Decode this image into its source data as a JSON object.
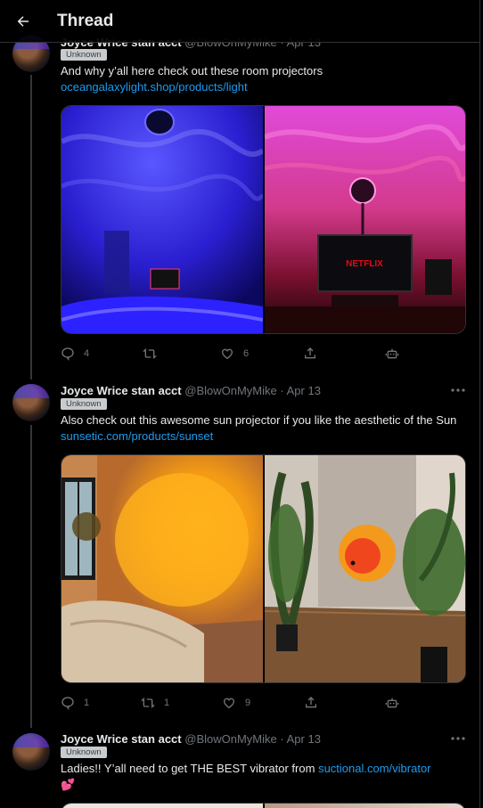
{
  "header": {
    "title": "Thread"
  },
  "tweets": [
    {
      "name": "Joyce Wrice stan acct",
      "handle": "@BlowOnMyMike",
      "date": "Apr 13",
      "badge": "Unknown",
      "text_before": "And why y’all here check out these room projectors",
      "link": "oceangalaxylight.shop/products/light",
      "reply_count": "4",
      "retweet_count": "",
      "like_count": "6"
    },
    {
      "name": "Joyce Wrice stan acct",
      "handle": "@BlowOnMyMike",
      "date": "Apr 13",
      "badge": "Unknown",
      "text_before": "Also check out this awesome sun projector if you like the aesthetic of the Sun",
      "link": "sunsetic.com/products/sunset",
      "reply_count": "1",
      "retweet_count": "1",
      "like_count": "9"
    },
    {
      "name": "Joyce Wrice stan acct",
      "handle": "@BlowOnMyMike",
      "date": "Apr 13",
      "badge": "Unknown",
      "text_before": "Ladies!! Y’all need to get THE BEST vibrator from",
      "link": "suctional.com/vibrator",
      "emoji": "💕"
    }
  ],
  "media_text": {
    "tv_label": "NETFLIX"
  },
  "icons": {
    "back": "arrow-left-icon",
    "reply": "reply-icon",
    "retweet": "retweet-icon",
    "like": "heart-icon",
    "share": "share-icon",
    "bot": "robot-icon",
    "more": "more-icon"
  },
  "colors": {
    "link": "#1d9bf0",
    "background": "#000000",
    "muted": "#71767b"
  }
}
